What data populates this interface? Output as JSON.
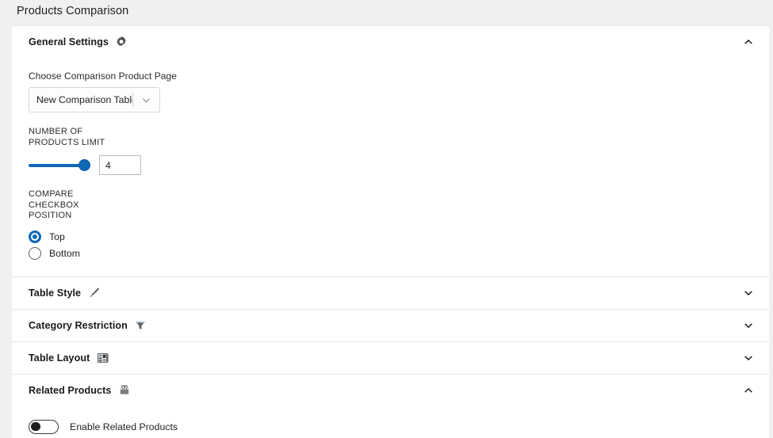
{
  "page": {
    "title": "Products Comparison"
  },
  "sections": [
    {
      "id": "general-settings",
      "title": "General Settings",
      "icon": "gear-icon",
      "expanded": true,
      "chevron": "chevron-up-icon"
    },
    {
      "id": "table-style",
      "title": "Table Style",
      "icon": "paintbrush-icon",
      "expanded": false,
      "chevron": "chevron-down-icon"
    },
    {
      "id": "category-restriction",
      "title": "Category Restriction",
      "icon": "funnel-icon",
      "expanded": false,
      "chevron": "chevron-down-icon"
    },
    {
      "id": "table-layout",
      "title": "Table Layout",
      "icon": "layout-grid-icon",
      "expanded": false,
      "chevron": "chevron-down-icon"
    },
    {
      "id": "related-products",
      "title": "Related Products",
      "icon": "shopping-bag-icon",
      "expanded": true,
      "chevron": "chevron-up-icon"
    }
  ],
  "general_settings": {
    "comparison_page": {
      "label": "Choose Comparison Product Page",
      "selected": "New Comparison Table",
      "arrow_icon": "chevron-down-icon"
    },
    "products_limit": {
      "label": "NUMBER OF PRODUCTS LIMIT",
      "value": "4",
      "slider_percent": 100
    },
    "checkbox_position": {
      "label": "COMPARE CHECKBOX POSITION",
      "options": [
        {
          "label": "Top",
          "selected": true
        },
        {
          "label": "Bottom",
          "selected": false
        }
      ]
    }
  },
  "related_products": {
    "enable_toggle": {
      "label": "Enable Related Products",
      "enabled": false
    }
  },
  "colors": {
    "accent": "#1068b8",
    "page_background": "#f0f0f0",
    "card_background": "#ffffff",
    "divider": "#e8e8e8",
    "text": "#1f1f1f"
  }
}
